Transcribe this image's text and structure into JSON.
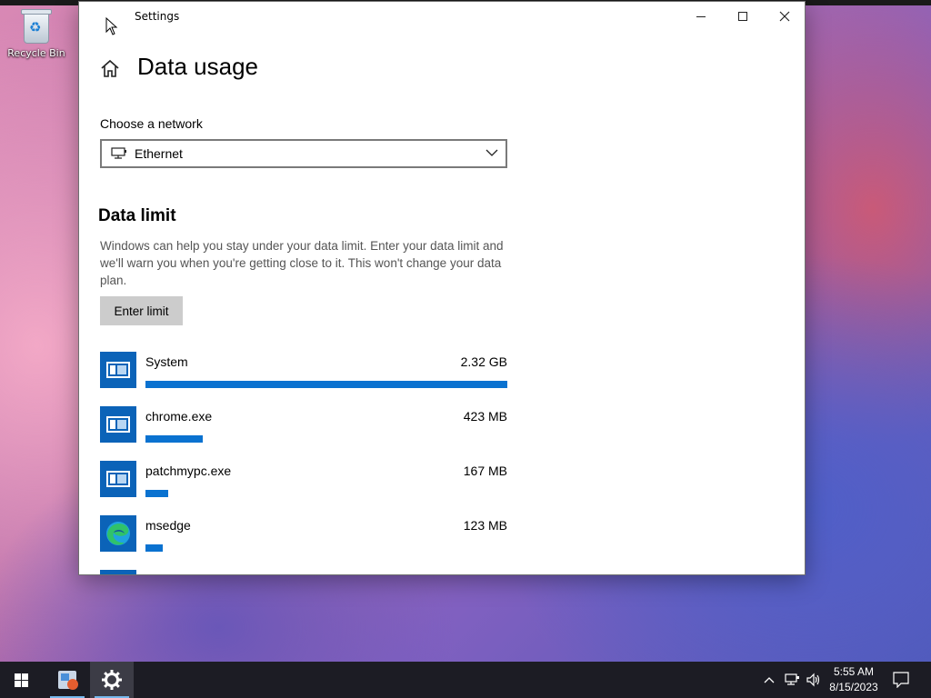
{
  "desktop": {
    "recycle_bin_label": "Recycle Bin"
  },
  "window": {
    "title": "Settings",
    "page_title": "Data usage",
    "network_label": "Choose a network",
    "network_selected": "Ethernet",
    "section_title": "Data limit",
    "section_description": "Windows can help you stay under your data limit. Enter your data limit and we'll warn you when you're getting close to it. This won't change your data plan.",
    "enter_limit_label": "Enter limit"
  },
  "apps": [
    {
      "name": "System",
      "usage": "2.32 GB",
      "share": 1.0,
      "icon": "app-window-icon"
    },
    {
      "name": "chrome.exe",
      "usage": "423 MB",
      "share": 0.159,
      "icon": "app-window-icon"
    },
    {
      "name": "patchmypc.exe",
      "usage": "167 MB",
      "share": 0.063,
      "icon": "app-window-icon"
    },
    {
      "name": "msedge",
      "usage": "123 MB",
      "share": 0.047,
      "icon": "edge-icon"
    }
  ],
  "taskbar": {
    "time": "5:55 AM",
    "date": "8/15/2023"
  },
  "colors": {
    "accent": "#0a72d0",
    "tile": "#0b63b8",
    "taskbar": "#1c1c24"
  }
}
